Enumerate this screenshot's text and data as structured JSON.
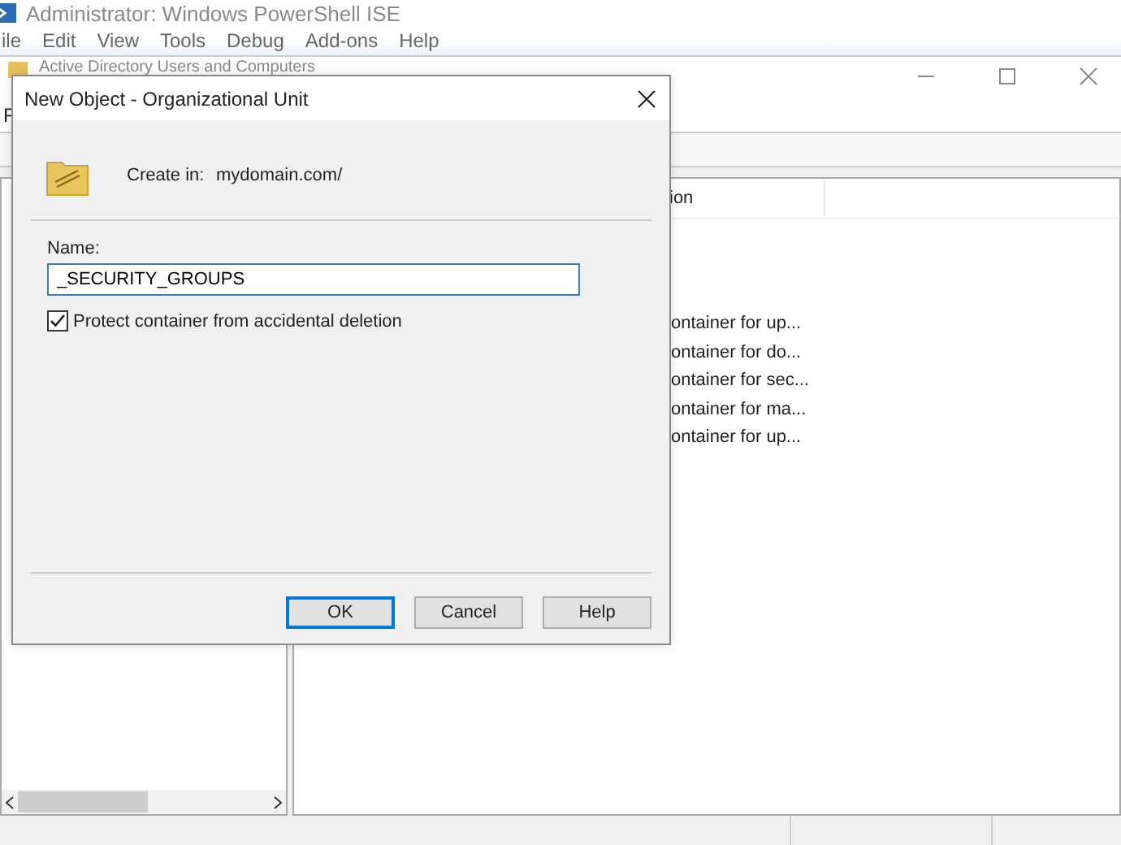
{
  "back_window": {
    "title": "Administrator: Windows PowerShell ISE",
    "menu": [
      "ile",
      "Edit",
      "View",
      "Tools",
      "Debug",
      "Add-ons",
      "Help"
    ]
  },
  "main_window": {
    "title": "Active Directory Users and Computers",
    "menu": [
      "F"
    ],
    "columns": [
      "ion"
    ],
    "rows": [
      "ontainer for up...",
      "ontainer for do...",
      "ontainer for sec...",
      "ontainer for ma...",
      "ontainer for up..."
    ]
  },
  "dialog": {
    "title": "New Object - Organizational Unit",
    "create_in_label": "Create in:",
    "create_in_value": "mydomain.com/",
    "name_label": "Name:",
    "name_value": "_SECURITY_GROUPS",
    "protect": {
      "label": "Protect container from accidental deletion",
      "checked": true
    },
    "buttons": [
      {
        "label": "OK",
        "default": true
      },
      {
        "label": "Cancel",
        "default": false
      },
      {
        "label": "Help",
        "default": false
      }
    ]
  }
}
